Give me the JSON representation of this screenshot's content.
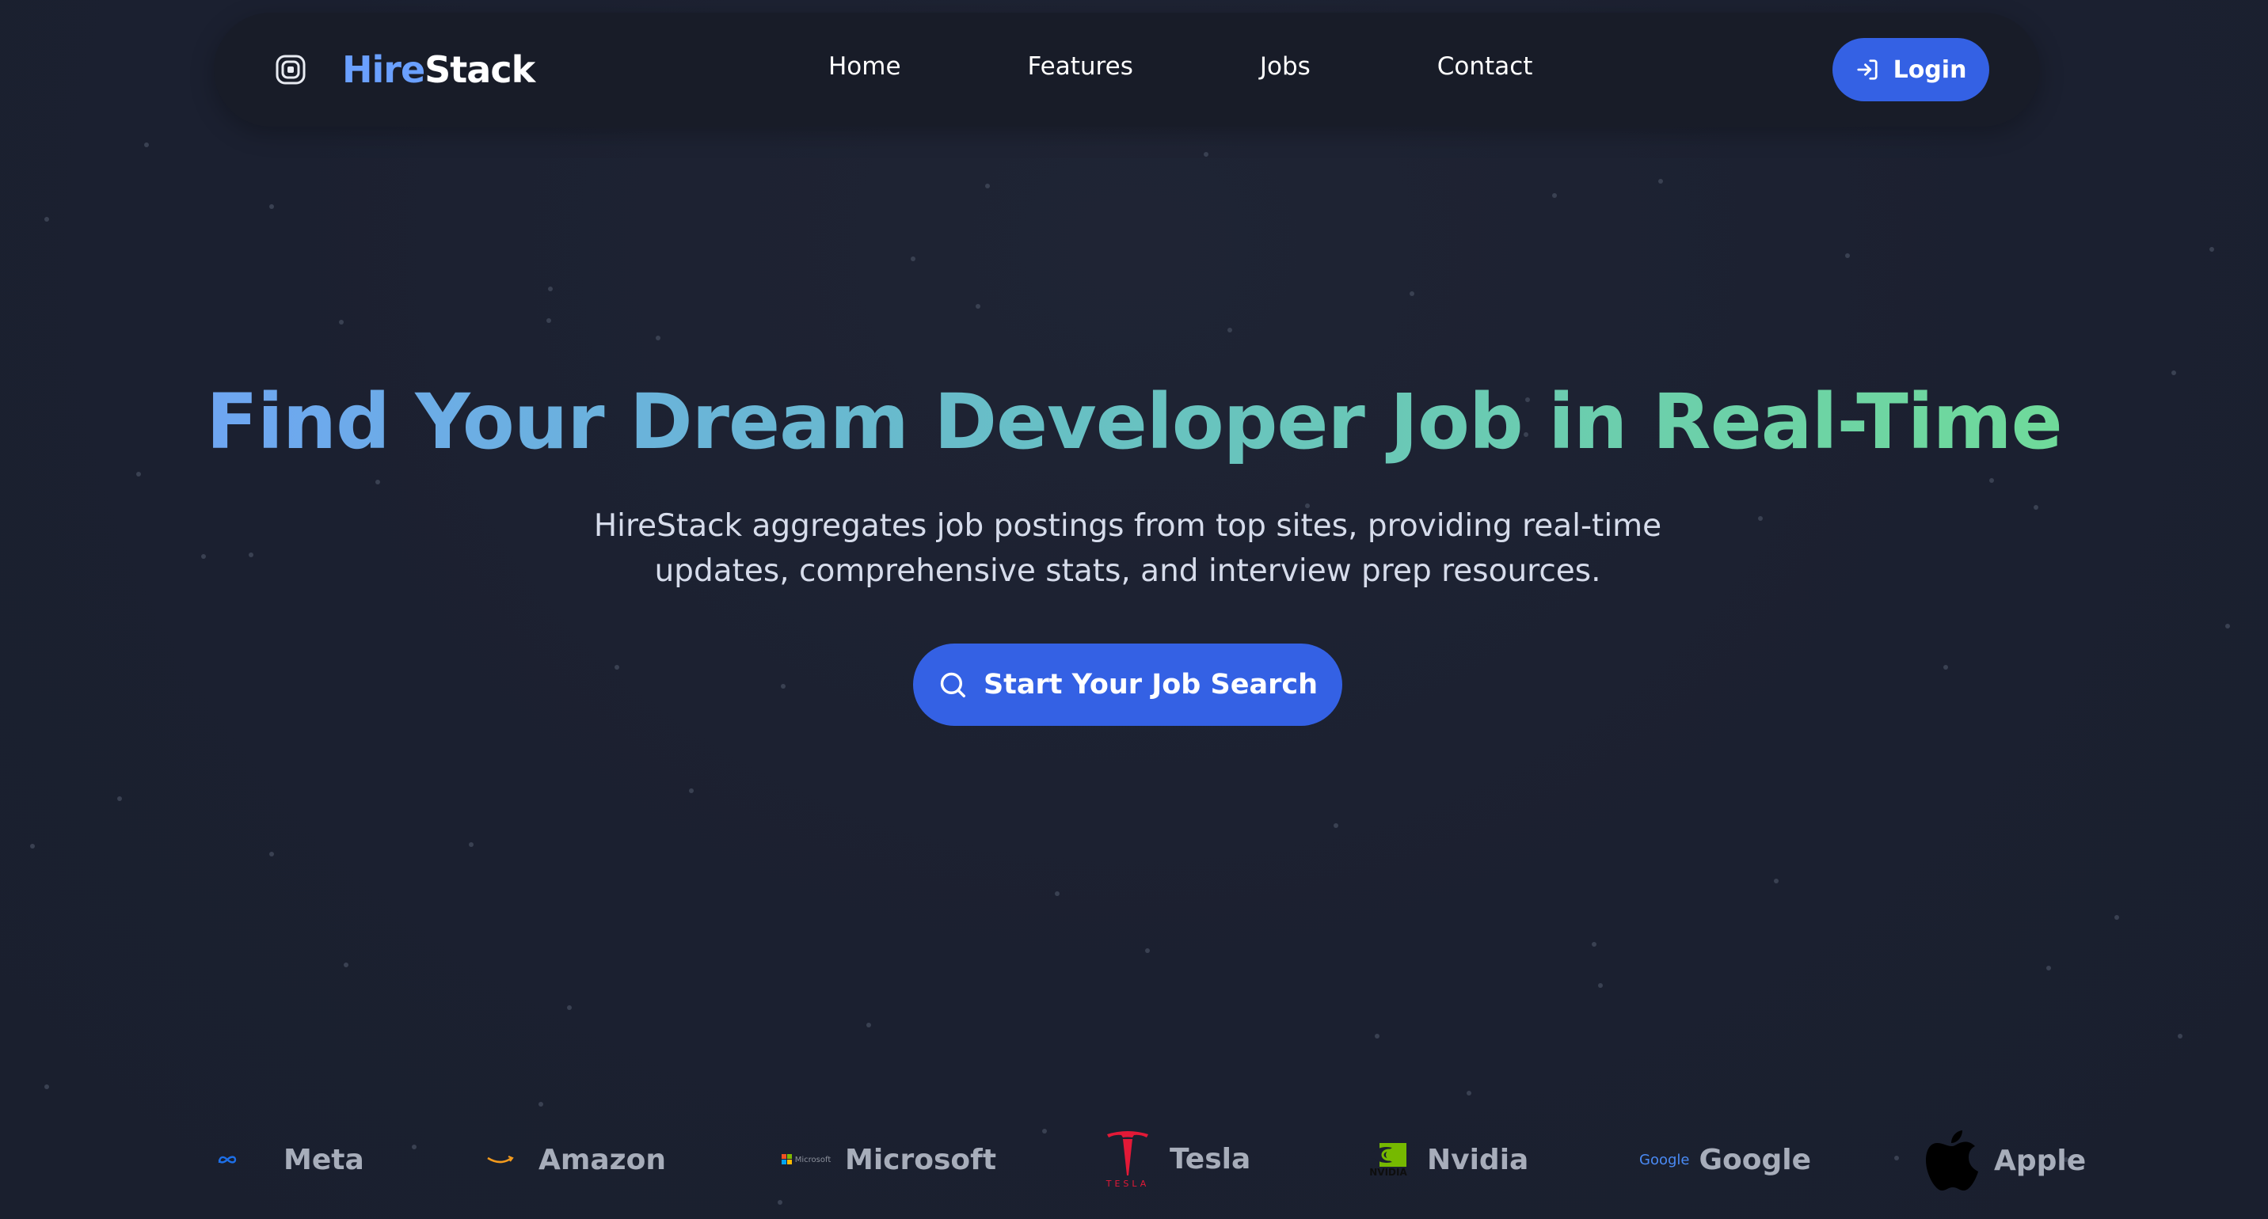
{
  "brand": {
    "part1": "Hire",
    "part2": "Stack",
    "icon": "layers-icon"
  },
  "nav": {
    "items": [
      {
        "label": "Home"
      },
      {
        "label": "Features"
      },
      {
        "label": "Jobs"
      },
      {
        "label": "Contact"
      }
    ],
    "login_label": "Login",
    "login_icon": "login-arrow-icon"
  },
  "hero": {
    "title": "Find Your Dream Developer Job in Real-Time",
    "subtitle": "HireStack aggregates job postings from top sites, providing real-time updates, comprehensive stats, and interview prep resources.",
    "cta_label": "Start Your Job Search",
    "cta_icon": "search-icon"
  },
  "companies": [
    {
      "name": "Meta",
      "icon": "meta-logo-icon",
      "logo_text": ""
    },
    {
      "name": "Amazon",
      "icon": "amazon-logo-icon",
      "logo_text": ""
    },
    {
      "name": "Microsoft",
      "icon": "microsoft-logo-icon",
      "logo_text": "Microsoft"
    },
    {
      "name": "Tesla",
      "icon": "tesla-logo-icon",
      "logo_text": "TESLA"
    },
    {
      "name": "Nvidia",
      "icon": "nvidia-logo-icon",
      "logo_text": "NVIDIA"
    },
    {
      "name": "Google",
      "icon": "google-logo-icon",
      "logo_text": "Google"
    },
    {
      "name": "Apple",
      "icon": "apple-logo-icon",
      "logo_text": ""
    }
  ],
  "colors": {
    "background": "#1c2130",
    "navbar": "#181c28",
    "accent": "#3461e4",
    "brand_blue": "#6aa0ff",
    "gradient_start": "#6ea6f2",
    "gradient_end": "#6fda9a"
  }
}
